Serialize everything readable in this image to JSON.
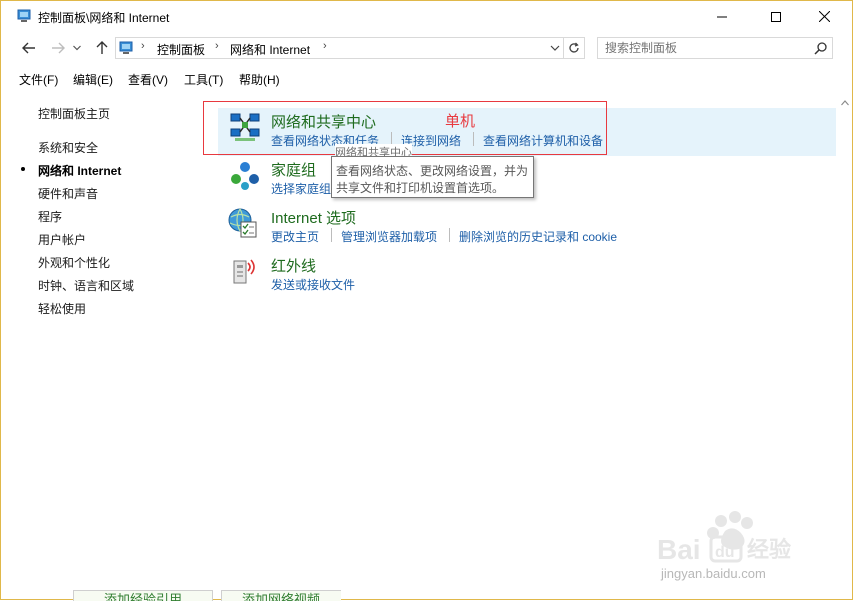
{
  "window": {
    "title": "控制面板\\网络和 Internet"
  },
  "address": {
    "crumbs": [
      "控制面板",
      "网络和 Internet"
    ],
    "search_placeholder": "搜索控制面板"
  },
  "menu": [
    "文件(F)",
    "编辑(E)",
    "查看(V)",
    "工具(T)",
    "帮助(H)"
  ],
  "sidebar": {
    "items": [
      {
        "label": "控制面板主页",
        "active": false
      },
      {
        "label": "系统和安全",
        "active": false
      },
      {
        "label": "网络和 Internet",
        "active": true
      },
      {
        "label": "硬件和声音",
        "active": false
      },
      {
        "label": "程序",
        "active": false
      },
      {
        "label": "用户帐户",
        "active": false
      },
      {
        "label": "外观和个性化",
        "active": false
      },
      {
        "label": "时钟、语言和区域",
        "active": false
      },
      {
        "label": "轻松使用",
        "active": false
      }
    ]
  },
  "categories": [
    {
      "title": "网络和共享中心",
      "icon": "network-sharing-center-icon",
      "links": [
        "查看网络状态和任务",
        "连接到网络",
        "查看网络计算机和设备"
      ]
    },
    {
      "title": "家庭组",
      "icon": "homegroup-icon",
      "links": [
        "选择家庭组"
      ]
    },
    {
      "title": "Internet 选项",
      "icon": "internet-options-icon",
      "links": [
        "更改主页",
        "管理浏览器加载项",
        "删除浏览的历史记录和 cookie"
      ]
    },
    {
      "title": "红外线",
      "icon": "infrared-icon",
      "links": [
        "发送或接收文件"
      ]
    }
  ],
  "annotation": {
    "label": "单机",
    "color": "#e8393f"
  },
  "tooltip": {
    "header": "网络和共享中心",
    "lines": [
      "查看网络状态、更改网络设置，并为",
      "共享文件和打印机设置首选项。"
    ]
  },
  "watermark": {
    "text": "jingyan.baidu.com",
    "logo_text": "Bai 经验"
  },
  "bottom_tabs": [
    "添加经验引用",
    "添加网络视频"
  ],
  "colors": {
    "title_green": "#1e6b1e",
    "link_blue": "#1e5fa8",
    "hover_bg": "#e5f3fb",
    "window_border": "#e0b84a"
  }
}
